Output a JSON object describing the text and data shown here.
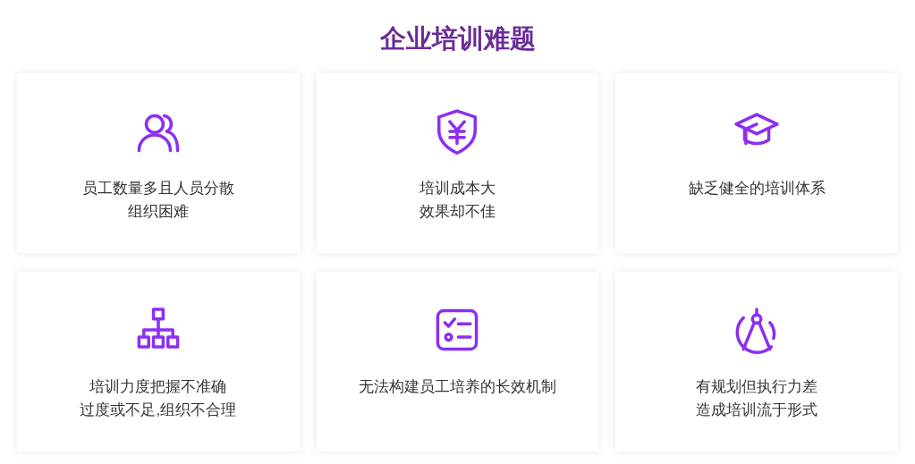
{
  "title": "企业培训难题",
  "cards": [
    {
      "lines": [
        "员工数量多且人员分散",
        "组织困难"
      ]
    },
    {
      "lines": [
        "培训成本大",
        "效果却不佳"
      ]
    },
    {
      "lines": [
        "缺乏健全的培训体系"
      ]
    },
    {
      "lines": [
        "培训力度把握不准确",
        "过度或不足,组织不合理"
      ]
    },
    {
      "lines": [
        "无法构建员工培养的长效机制"
      ]
    },
    {
      "lines": [
        "有规划但执行力差",
        "造成培训流于形式"
      ]
    }
  ]
}
